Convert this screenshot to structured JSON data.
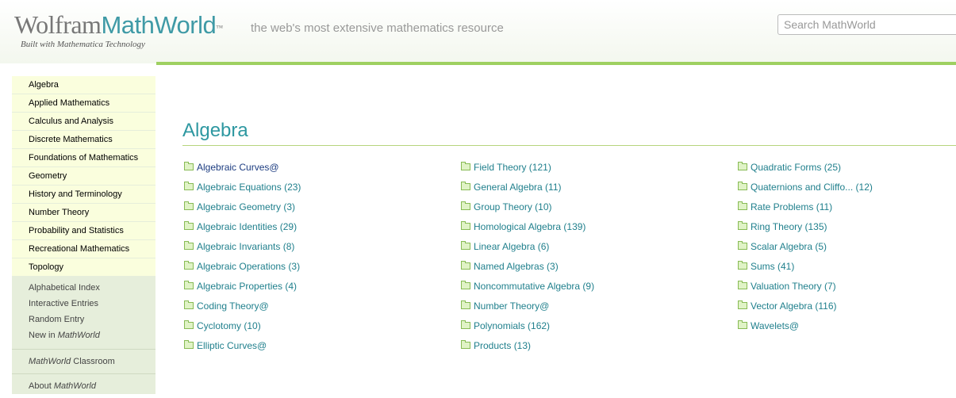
{
  "header": {
    "logo_wolfram": "Wolfram",
    "logo_mathworld": "MathWorld",
    "logo_tm": "™",
    "logo_subtitle": "Built with Mathematica Technology",
    "tagline": "the web's most extensive mathematics resource",
    "search_placeholder": "Search MathWorld"
  },
  "colors": {
    "accent": "#9ed060",
    "title": "#2e98a1",
    "link": "#1f7f8c"
  },
  "sidebar": {
    "categories": [
      {
        "label": "Algebra"
      },
      {
        "label": "Applied Mathematics"
      },
      {
        "label": "Calculus and Analysis"
      },
      {
        "label": "Discrete Mathematics"
      },
      {
        "label": "Foundations of Mathematics"
      },
      {
        "label": "Geometry"
      },
      {
        "label": "History and Terminology"
      },
      {
        "label": "Number Theory"
      },
      {
        "label": "Probability and Statistics"
      },
      {
        "label": "Recreational Mathematics"
      },
      {
        "label": "Topology"
      }
    ],
    "links": [
      {
        "label": "Alphabetical Index"
      },
      {
        "label": "Interactive Entries"
      },
      {
        "label": "Random Entry"
      },
      {
        "label_pre": "New in ",
        "label_em": "MathWorld"
      }
    ],
    "classroom": {
      "label_em": "MathWorld",
      "label_post": " Classroom"
    },
    "about": {
      "label_pre": "About ",
      "label_em": "MathWorld"
    }
  },
  "main": {
    "title": "Algebra",
    "columns": [
      [
        {
          "label": "Algebraic Curves@"
        },
        {
          "label": "Algebraic Equations (23)"
        },
        {
          "label": "Algebraic Geometry (3)"
        },
        {
          "label": "Algebraic Identities (29)"
        },
        {
          "label": "Algebraic Invariants (8)"
        },
        {
          "label": "Algebraic Operations (3)"
        },
        {
          "label": "Algebraic Properties (4)"
        },
        {
          "label": "Coding Theory@"
        },
        {
          "label": "Cyclotomy (10)"
        },
        {
          "label": "Elliptic Curves@"
        }
      ],
      [
        {
          "label": "Field Theory (121)"
        },
        {
          "label": "General Algebra (11)"
        },
        {
          "label": "Group Theory (10)"
        },
        {
          "label": "Homological Algebra (139)"
        },
        {
          "label": "Linear Algebra (6)"
        },
        {
          "label": "Named Algebras (3)"
        },
        {
          "label": "Noncommutative Algebra (9)"
        },
        {
          "label": "Number Theory@"
        },
        {
          "label": "Polynomials (162)"
        },
        {
          "label": "Products (13)"
        }
      ],
      [
        {
          "label": "Quadratic Forms (25)"
        },
        {
          "label": "Quaternions and Cliffo... (12)"
        },
        {
          "label": "Rate Problems (11)"
        },
        {
          "label": "Ring Theory (135)"
        },
        {
          "label": "Scalar Algebra (5)"
        },
        {
          "label": "Sums (41)"
        },
        {
          "label": "Valuation Theory (7)"
        },
        {
          "label": "Vector Algebra (116)"
        },
        {
          "label": "Wavelets@"
        }
      ]
    ]
  }
}
